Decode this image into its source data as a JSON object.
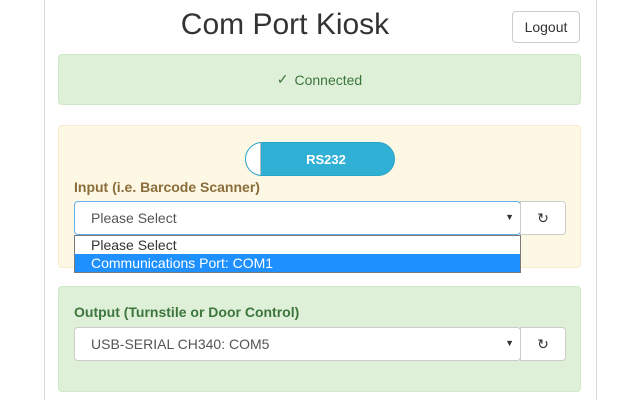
{
  "header": {
    "title": "Com Port Kiosk",
    "logout_label": "Logout"
  },
  "status": {
    "icon": "check-icon",
    "check_glyph": "✓",
    "text": "Connected",
    "color": "#3c763d"
  },
  "input_panel": {
    "toggle_label": "RS232",
    "label": "Input (i.e. Barcode Scanner)",
    "selected_value": "Please Select",
    "options": [
      {
        "label": "Please Select",
        "highlighted": false
      },
      {
        "label": "Communications Port: COM1",
        "highlighted": true
      }
    ],
    "refresh_icon": "refresh-icon",
    "refresh_glyph": "↻",
    "caret_glyph": "▼"
  },
  "output_panel": {
    "label": "Output (Turnstile or Door Control)",
    "selected_value": "USB-SERIAL CH340: COM5",
    "refresh_icon": "refresh-icon",
    "refresh_glyph": "↻",
    "caret_glyph": "▼"
  },
  "colors": {
    "success_bg": "#dff0d8",
    "warning_bg": "#fcf8e3",
    "toggle_bg": "#31b0d5",
    "highlight": "#1e90ff"
  }
}
